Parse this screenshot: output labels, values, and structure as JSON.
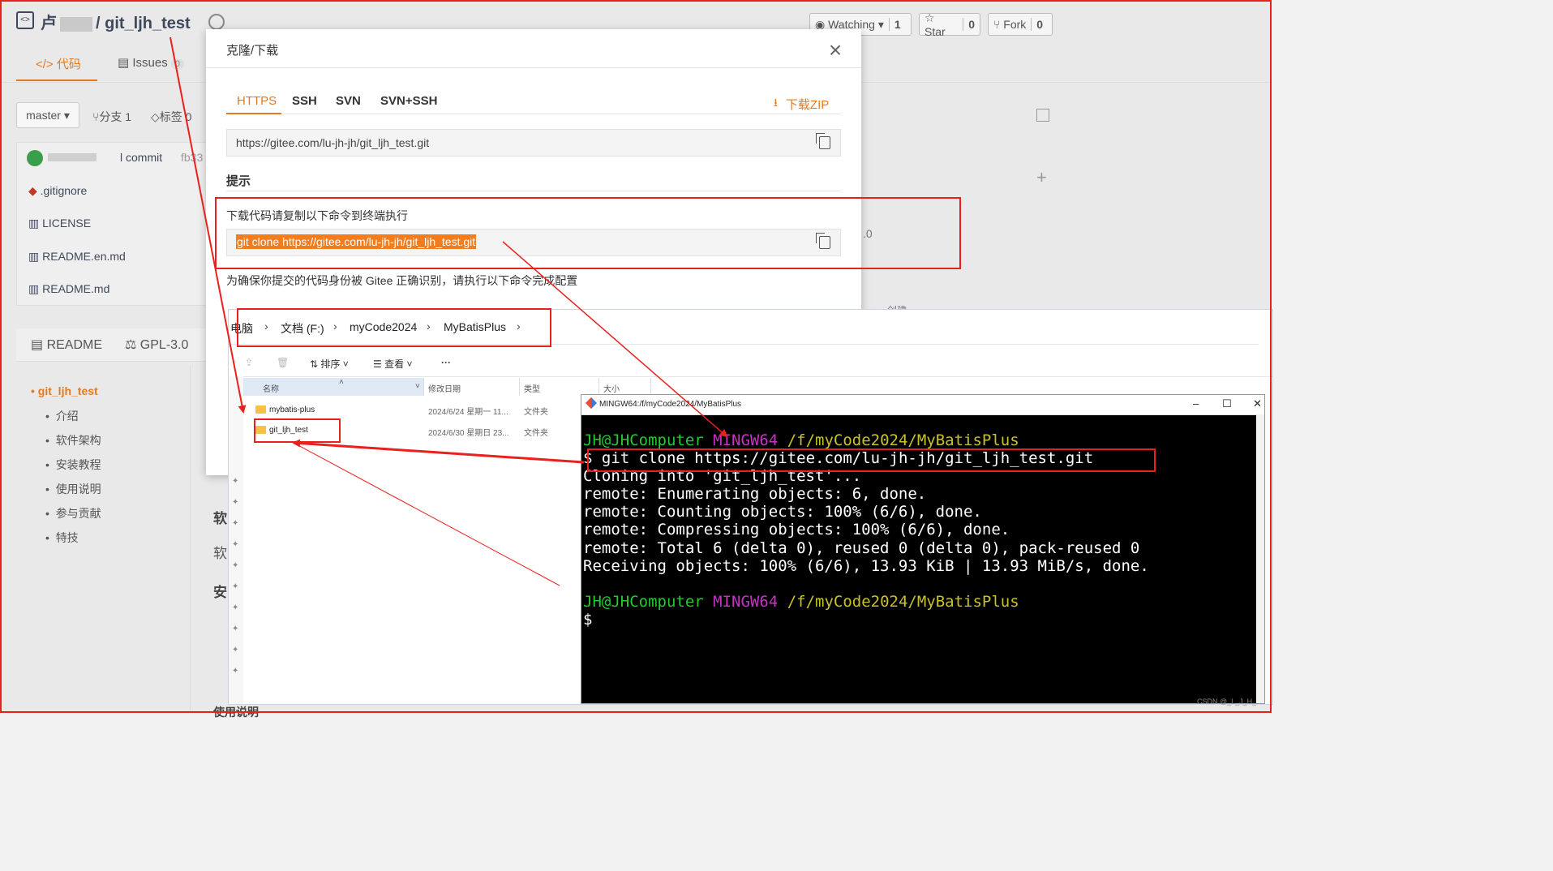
{
  "bg": {
    "repo_owner": "卢",
    "repo_sep": "/",
    "repo_name": "git_ljh_test",
    "watch_label": "Watching",
    "watch_count": "1",
    "star_label": "Star",
    "star_count": "0",
    "fork_label": "Fork",
    "fork_count": "0",
    "tab_code": "代码",
    "tab_issues": "Issues",
    "tab_issues_count": "0",
    "branch": "master",
    "branches": "分支 1",
    "tags": "标签 0",
    "commit_text": "l commit",
    "commit_hash": "fb33",
    "files": [
      ".gitignore",
      "LICENSE",
      "README.en.md",
      "README.md"
    ],
    "readme_tab": "README",
    "license_tab": "GPL-3.0",
    "toc_main": "git_ljh_test",
    "toc": [
      "介绍",
      "软件架构",
      "安装教程",
      "使用说明",
      "参与贡献",
      "特技"
    ],
    "side_fragments": [
      "软",
      "软",
      "安",
      "使用说明"
    ],
    "right_fragment_1": ".0",
    "right_fragment_2": "创建"
  },
  "modal": {
    "title": "克隆/下载",
    "tabs": [
      "HTTPS",
      "SSH",
      "SVN",
      "SVN+SSH"
    ],
    "download_zip": "下载ZIP",
    "url": "https://gitee.com/lu-jh-jh/git_ljh_test.git",
    "tip_title": "提示",
    "tip_instruction": "下载代码请复制以下命令到终端执行",
    "clone_cmd": "git clone https://gitee.com/lu-jh-jh/git_ljh_test.git",
    "identity_note": "为确保你提交的代码身份被 Gitee 正确识别，请执行以下命令完成配置"
  },
  "explorer": {
    "breadcrumb": [
      "电脑",
      "文档 (F:)",
      "myCode2024",
      "MyBatisPlus"
    ],
    "toolbar": {
      "sort": "排序",
      "view": "查看",
      "more": "···"
    },
    "columns": [
      "名称",
      "修改日期",
      "类型",
      "大小"
    ],
    "rows": [
      {
        "name": "mybatis-plus",
        "date": "2024/6/24  星期一 11...",
        "type": "文件夹"
      },
      {
        "name": "git_ljh_test",
        "date": "2024/6/30  星期日 23...",
        "type": "文件夹"
      }
    ]
  },
  "terminal": {
    "title": "MINGW64:/f/myCode2024/MyBatisPlus",
    "prompt_user": "JH@JHComputer",
    "prompt_env": "MINGW64",
    "prompt_path": "/f/myCode2024/MyBatisPlus",
    "cmd": "git clone https://gitee.com/lu-jh-jh/git_ljh_test.git",
    "output": [
      "Cloning into 'git_ljh_test'...",
      "remote: Enumerating objects: 6, done.",
      "remote: Counting objects: 100% (6/6), done.",
      "remote: Compressing objects: 100% (6/6), done.",
      "remote: Total 6 (delta 0), reused 0 (delta 0), pack-reused 0",
      "Receiving objects: 100% (6/6), 13.93 KiB | 13.93 MiB/s, done."
    ],
    "dollar": "$"
  },
  "watermark": "CSDN @_L_J_H_",
  "colors": {
    "accent": "#e07b24",
    "annotation_red": "#e8211d",
    "term_green": "#23c92e",
    "term_magenta": "#c236c2",
    "term_yellow": "#c9c227"
  }
}
